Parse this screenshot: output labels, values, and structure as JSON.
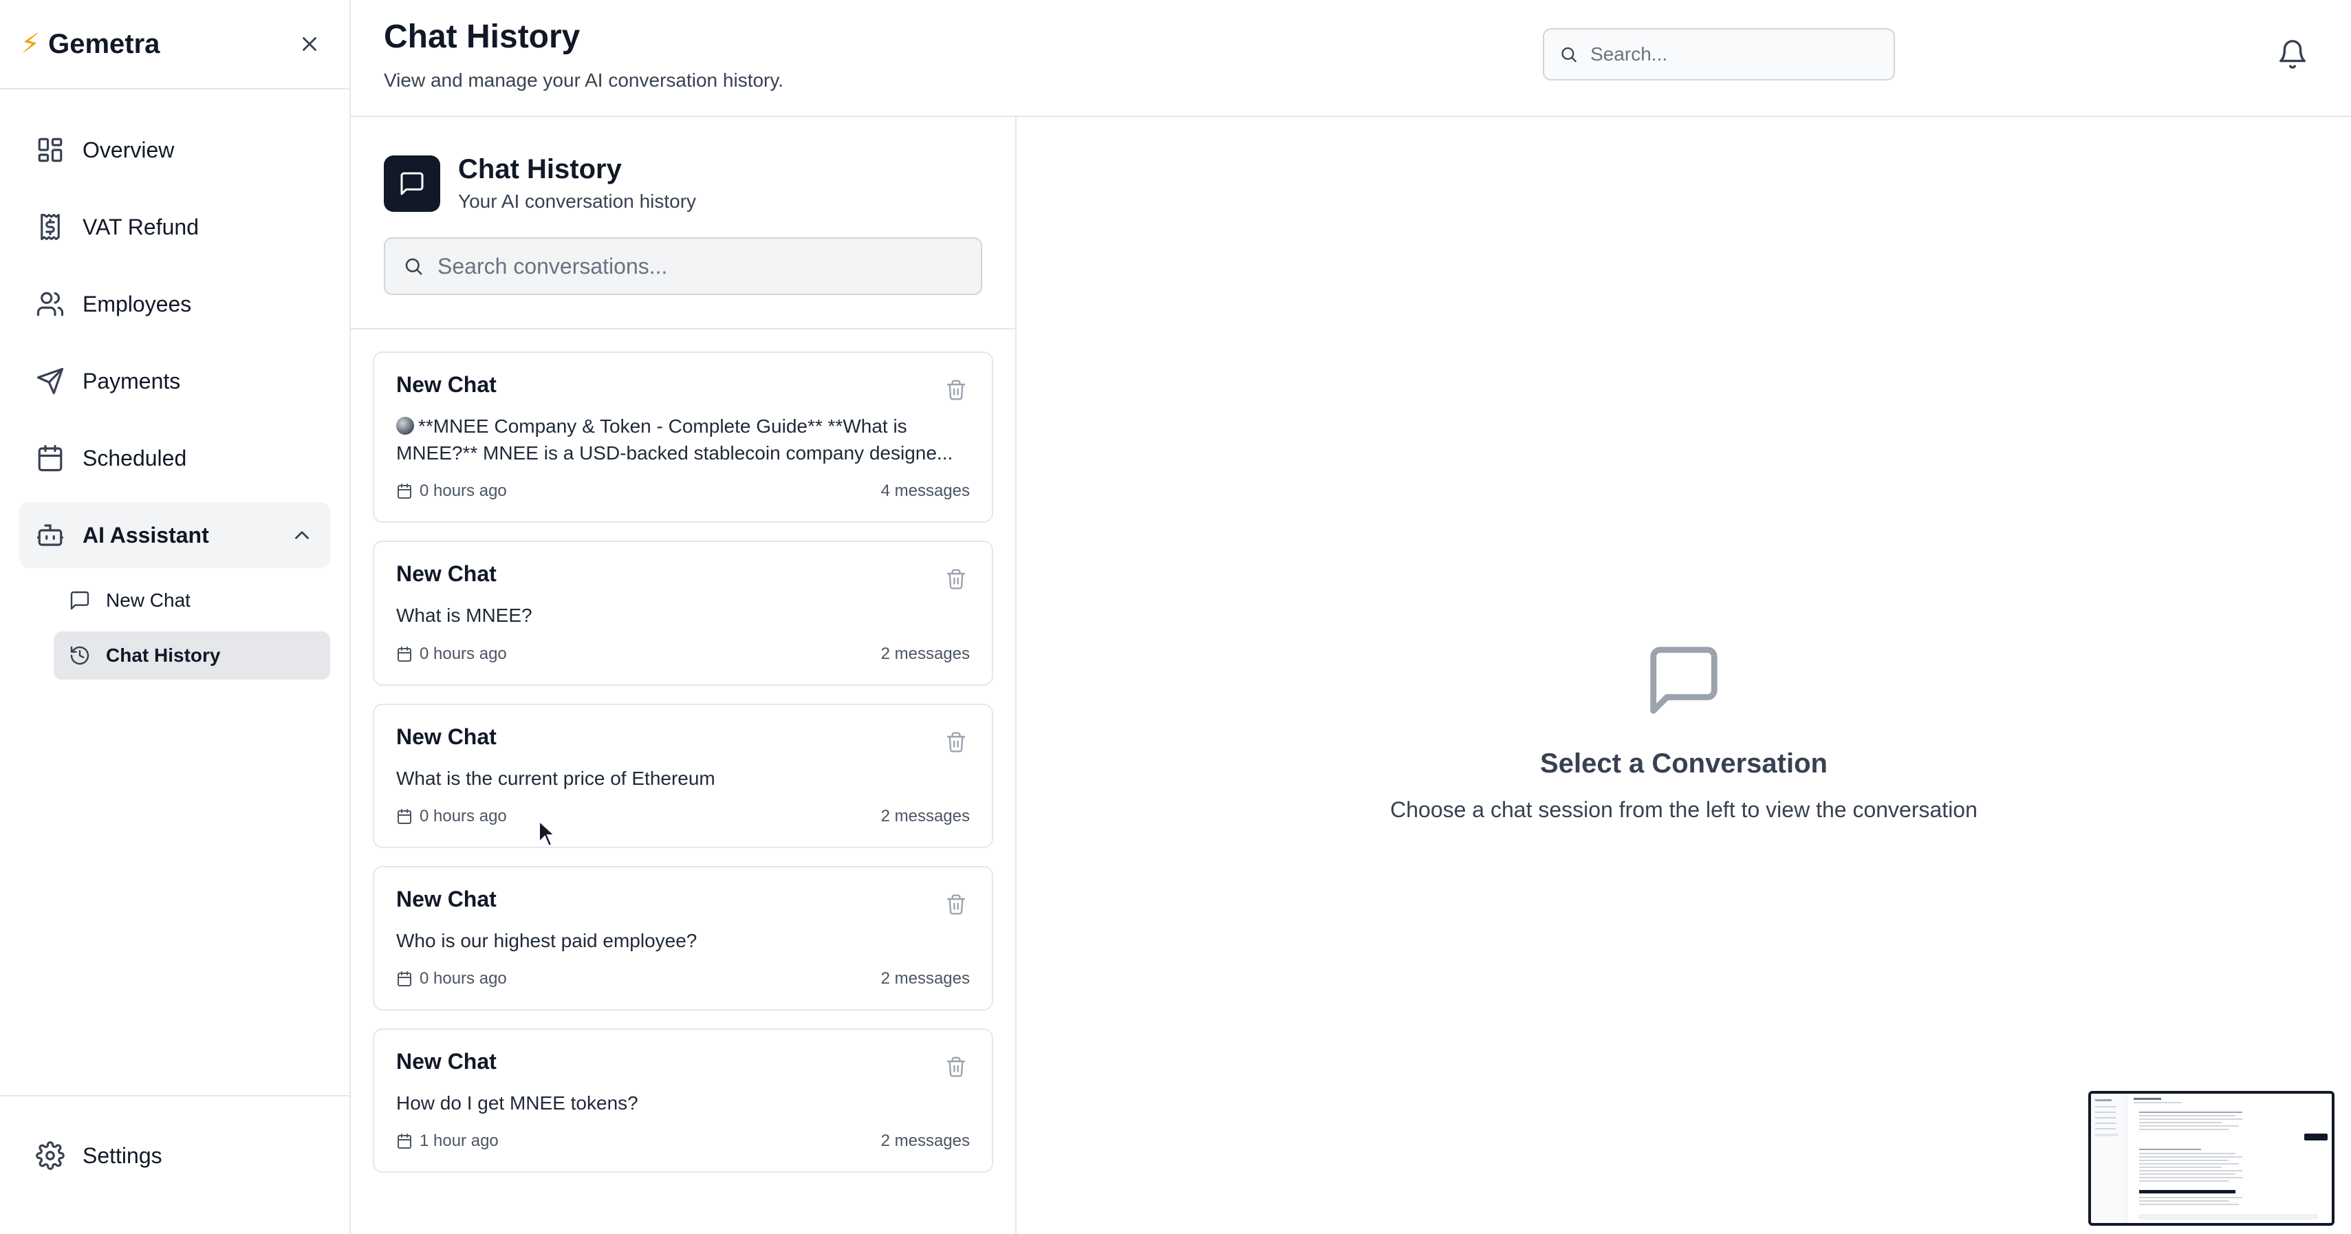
{
  "app": {
    "brand": "Gemetra"
  },
  "sidebar": {
    "items": [
      {
        "label": "Overview",
        "icon": "grid-icon"
      },
      {
        "label": "VAT Refund",
        "icon": "receipt-dollar-icon"
      },
      {
        "label": "Employees",
        "icon": "users-icon"
      },
      {
        "label": "Payments",
        "icon": "send-icon"
      },
      {
        "label": "Scheduled",
        "icon": "calendar-icon"
      },
      {
        "label": "AI Assistant",
        "icon": "bot-icon",
        "expanded": true
      }
    ],
    "subitems": [
      {
        "label": "New Chat",
        "icon": "message-square-icon"
      },
      {
        "label": "Chat History",
        "icon": "history-icon",
        "active": true
      }
    ],
    "footer": {
      "label": "Settings",
      "icon": "gear-icon"
    }
  },
  "header": {
    "title": "Chat History",
    "subtitle": "View and manage your AI conversation history.",
    "search_placeholder": "Search..."
  },
  "list": {
    "title": "Chat History",
    "subtitle": "Your AI conversation history",
    "search_placeholder": "Search conversations...",
    "sessions": [
      {
        "title": "New Chat",
        "preview": "**MNEE Company & Token - Complete Guide** **What is MNEE?** MNEE is a USD-backed stablecoin company designe...",
        "time": "0 hours ago",
        "count": "4 messages"
      },
      {
        "title": "New Chat",
        "preview": "What is MNEE?",
        "time": "0 hours ago",
        "count": "2 messages"
      },
      {
        "title": "New Chat",
        "preview": "What is the current price of Ethereum",
        "time": "0 hours ago",
        "count": "2 messages"
      },
      {
        "title": "New Chat",
        "preview": "Who is our highest paid employee?",
        "time": "0 hours ago",
        "count": "2 messages"
      },
      {
        "title": "New Chat",
        "preview": "How do I get MNEE tokens?",
        "time": "1 hour ago",
        "count": "2 messages"
      }
    ]
  },
  "empty_state": {
    "title": "Select a Conversation",
    "subtitle": "Choose a chat session from the left to view the conversation"
  },
  "colors": {
    "text": "#111827",
    "muted": "#6b7280",
    "border": "#e5e7eb",
    "active_bg": "#e5e7eb",
    "accent_bolt": "#f59e0b"
  }
}
